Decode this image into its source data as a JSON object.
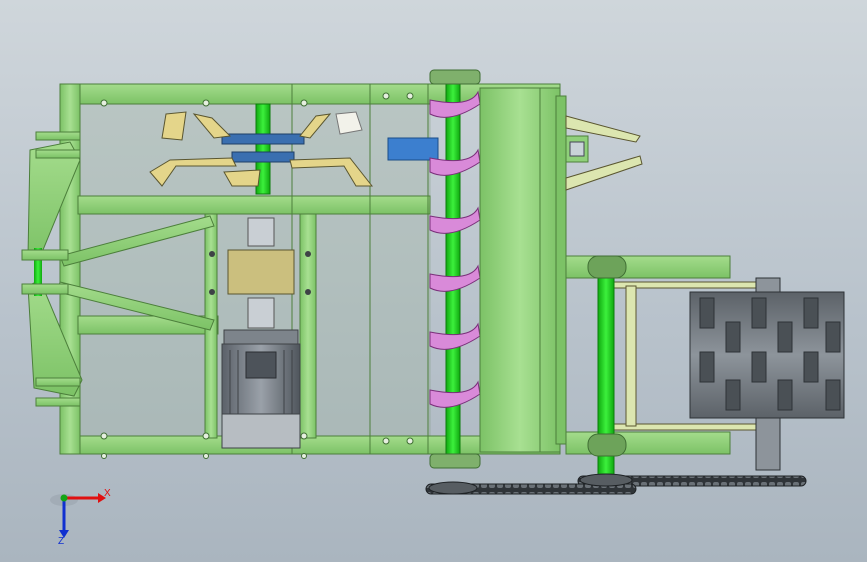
{
  "viewport": {
    "background_top": "#cfd6db",
    "background_bottom": "#aab5bf"
  },
  "colors": {
    "frame": "#8fd07a",
    "frame_dark": "#5e9e4a",
    "shaft": "#1fd21f",
    "auger": "#d67cd6",
    "motor": "#8a9199",
    "chain": "#3a3f44",
    "guard": "#dce6b0",
    "blue_box": "#3c7fcf",
    "roller": "#6c7379"
  },
  "triad": {
    "x_label": "X",
    "z_label": "Z",
    "x_color": "#e01010",
    "y_color": "#15a515",
    "z_color": "#1030d0"
  }
}
